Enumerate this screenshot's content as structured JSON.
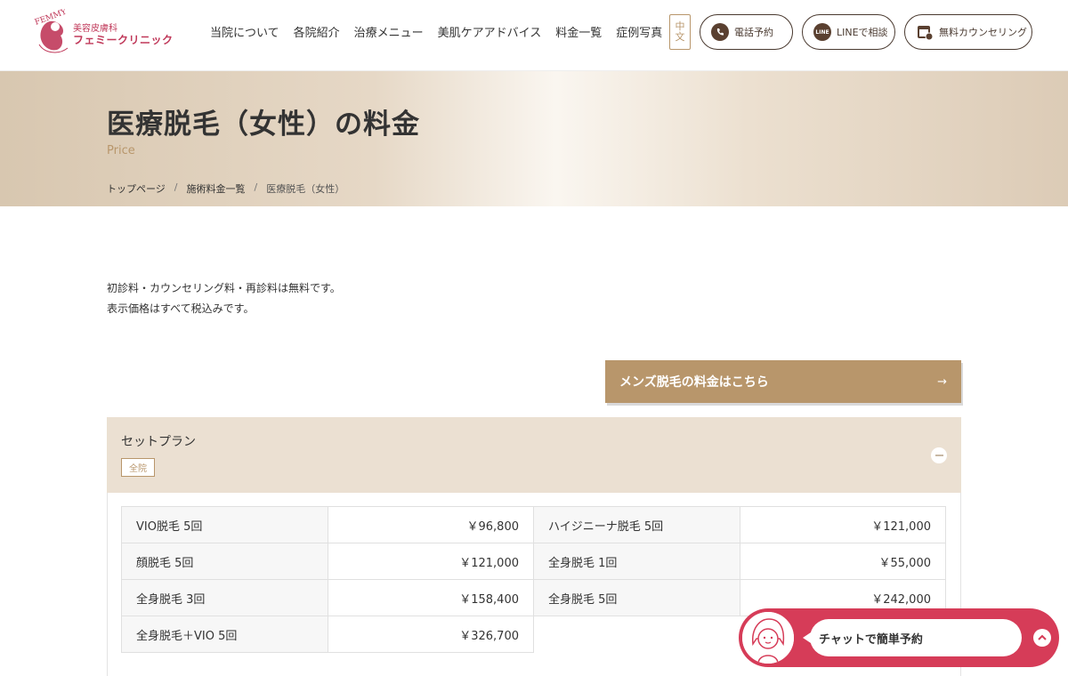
{
  "header": {
    "logo": {
      "sub": "美容皮膚科",
      "main": "フェミークリニック",
      "mark_text": "FEMMY"
    },
    "nav": [
      "当院について",
      "各院紹介",
      "治療メニュー",
      "美肌ケアアドバイス",
      "料金一覧",
      "症例写真"
    ],
    "lang": {
      "line1": "中",
      "line2": "文"
    },
    "buttons": {
      "tel": {
        "label": "電話予約",
        "icon": "phone-icon"
      },
      "line": {
        "label": "LINEで相談",
        "icon": "line-icon"
      },
      "counsel": {
        "label": "無料カウンセリング",
        "icon": "calendar-icon"
      }
    }
  },
  "hero": {
    "title": "医療脱毛（女性）の料金",
    "subtitle": "Price",
    "breadcrumb": [
      "トップページ",
      "施術料金一覧",
      "医療脱毛（女性）"
    ],
    "separator": "/"
  },
  "intro": {
    "line1": "初診料・カウンセリング料・再診料は無料です。",
    "line2": "表示価格はすべて税込みです。"
  },
  "mens_button": {
    "label": "メンズ脱毛の料金はこちら",
    "arrow": "→"
  },
  "accordion": {
    "title": "セットプラン",
    "tag": "全院",
    "rows": [
      {
        "left_name": "VIO脱毛 5回",
        "left_price": "￥96,800",
        "right_name": "ハイジニーナ脱毛 5回",
        "right_price": "￥121,000"
      },
      {
        "left_name": "顔脱毛 5回",
        "left_price": "￥121,000",
        "right_name": "全身脱毛 1回",
        "right_price": "￥55,000"
      },
      {
        "left_name": "全身脱毛 3回",
        "left_price": "￥158,400",
        "right_name": "全身脱毛 5回",
        "right_price": "￥242,000"
      },
      {
        "left_name": "全身脱毛＋VIO 5回",
        "left_price": "￥326,700",
        "right_name": "",
        "right_price": ""
      }
    ]
  },
  "chat": {
    "label": "チャットで簡単予約"
  },
  "colors": {
    "accent": "#b8966b",
    "chat": "#d63c58",
    "brand": "#c0395a"
  }
}
